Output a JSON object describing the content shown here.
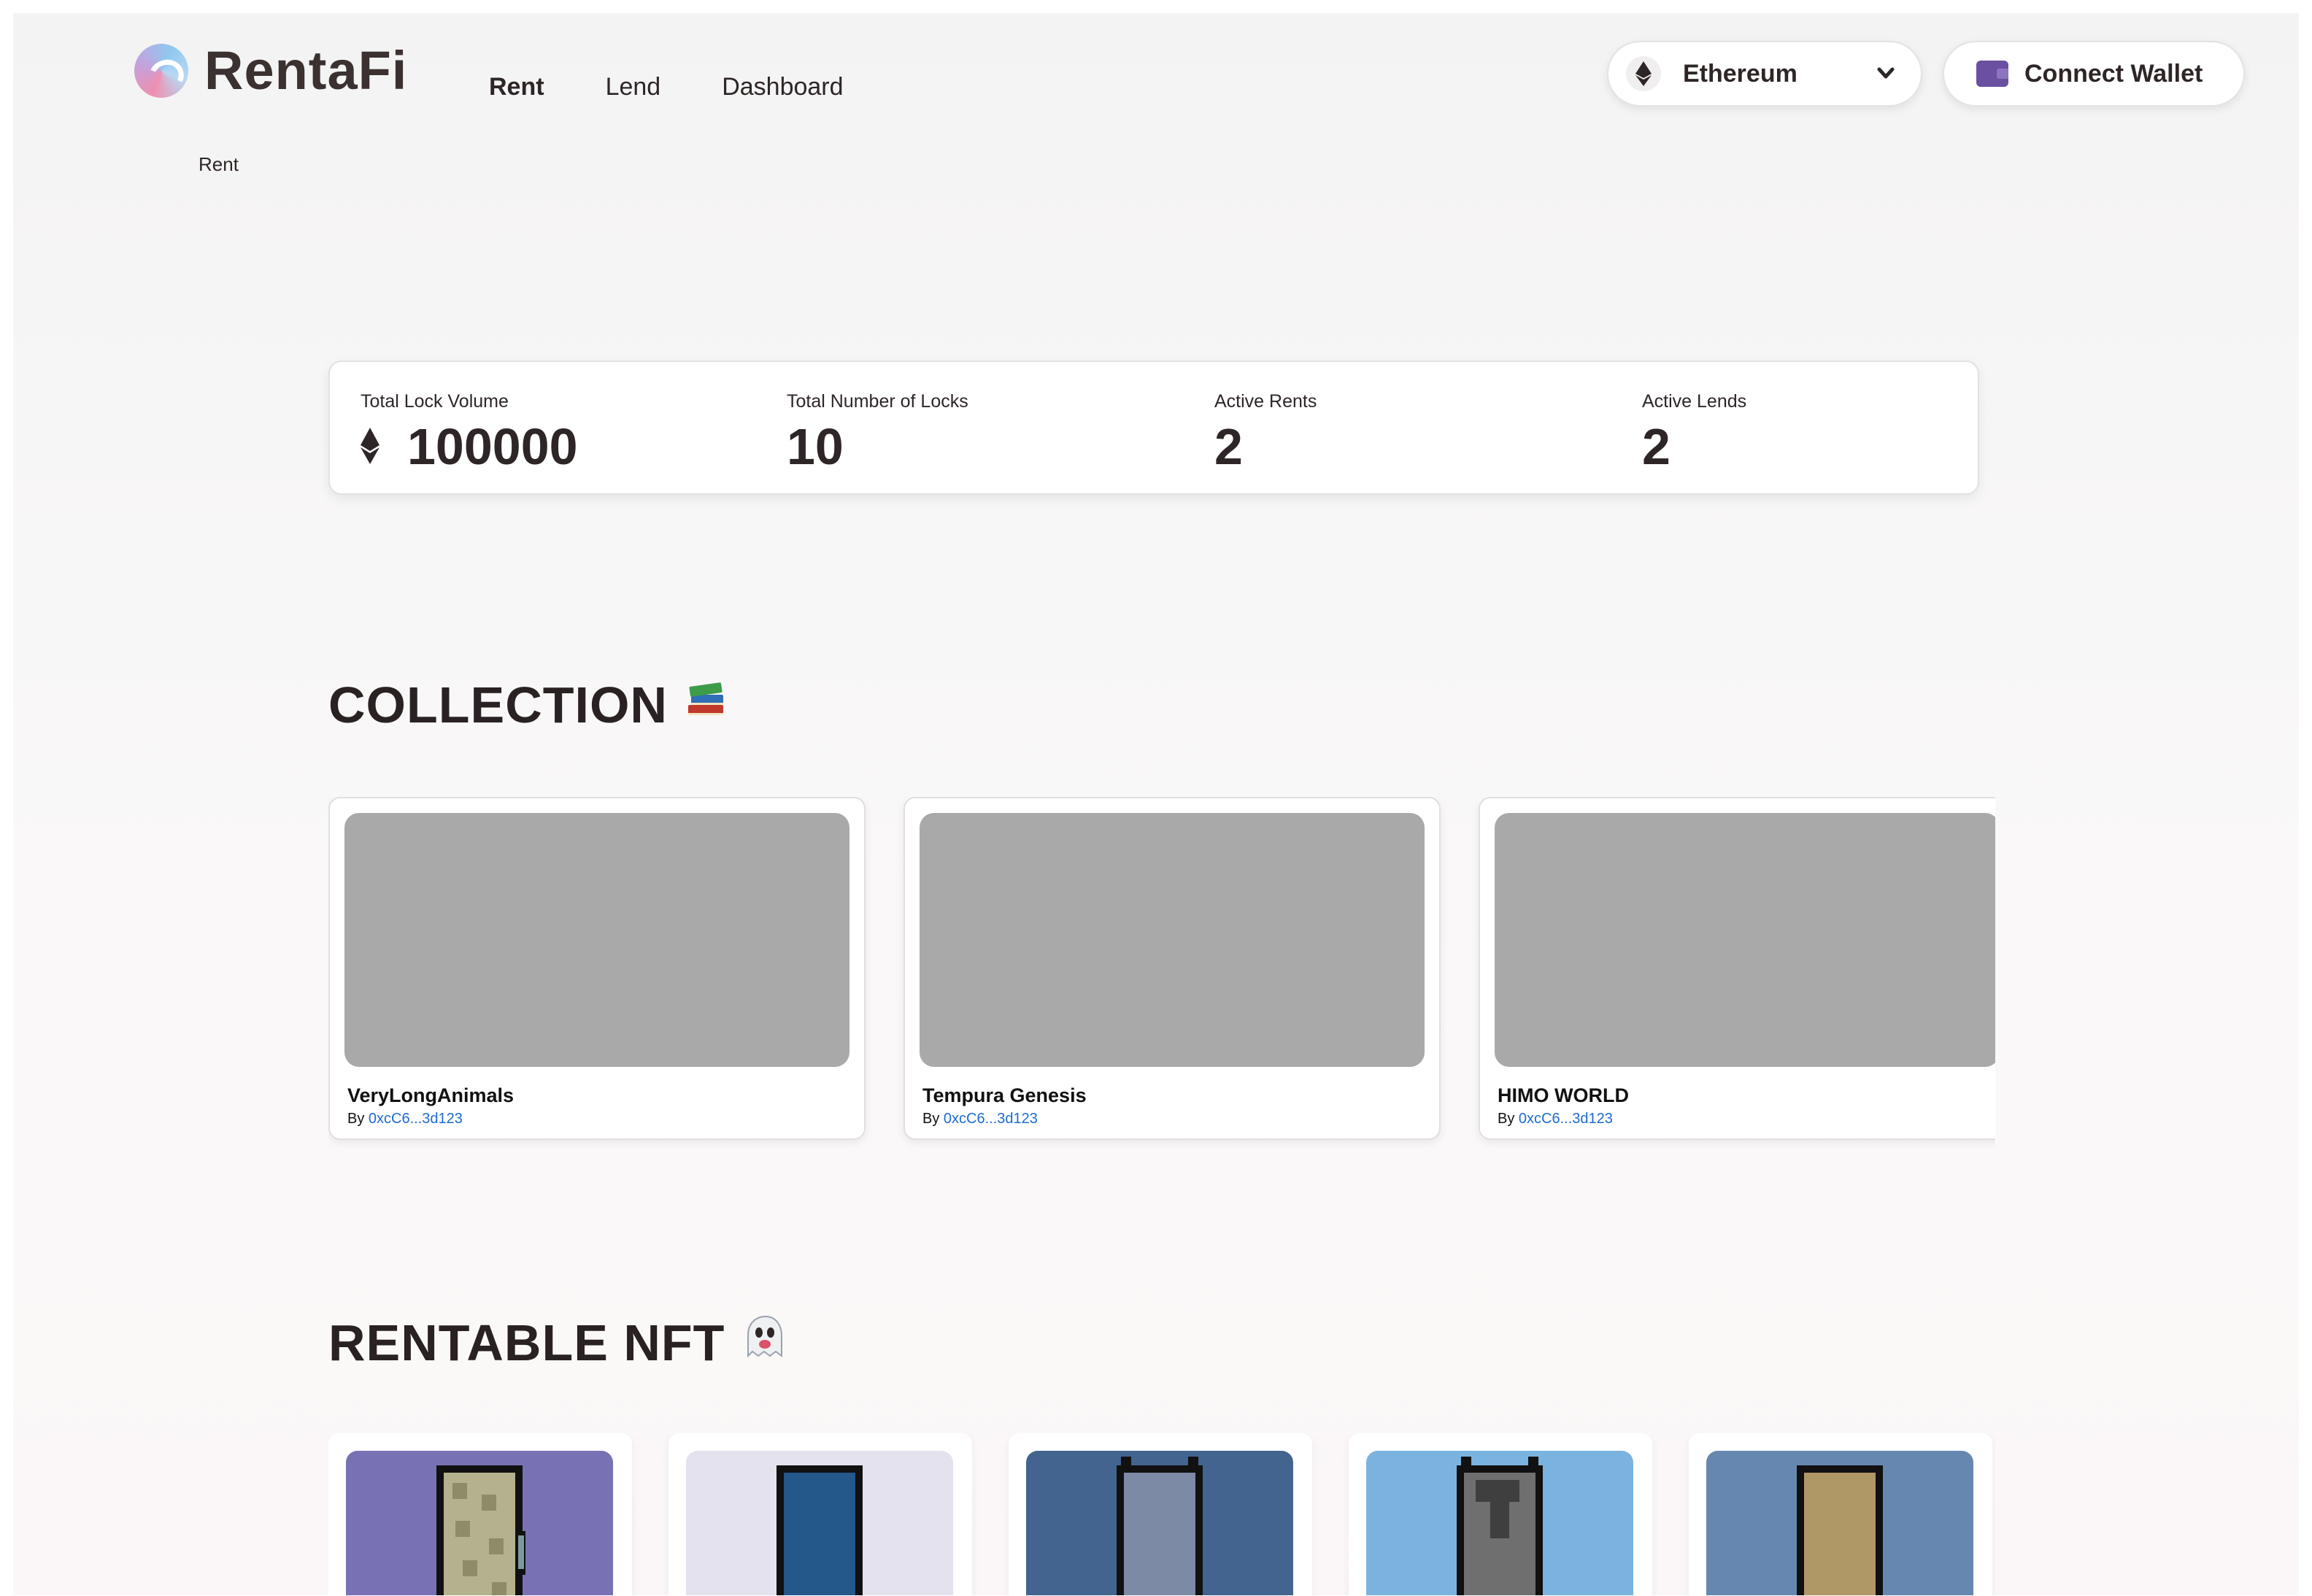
{
  "header": {
    "logo_text": "RentaFi",
    "nav": [
      {
        "label": "Rent",
        "active": true
      },
      {
        "label": "Lend",
        "active": false
      },
      {
        "label": "Dashboard",
        "active": false
      }
    ],
    "chain_select": {
      "value": "Ethereum",
      "icon": "ethereum-icon"
    },
    "wallet_button": {
      "label": "Connect Wallet",
      "icon": "wallet-icon"
    }
  },
  "breadcrumb": "Rent",
  "stats": [
    {
      "label": "Total Lock Volume",
      "value": "100000",
      "icon": "ethereum-icon"
    },
    {
      "label": "Total Number of Locks",
      "value": "10"
    },
    {
      "label": "Active Rents",
      "value": "2"
    },
    {
      "label": "Active Lends",
      "value": "2"
    }
  ],
  "collection": {
    "title": "COLLECTION",
    "emoji": "📚",
    "items": [
      {
        "name": "VeryLongAnimals",
        "by_label": "By",
        "creator": "0xcC6...3d123"
      },
      {
        "name": "Tempura Genesis",
        "by_label": "By",
        "creator": "0xcC6...3d123"
      },
      {
        "name": "HIMO WORLD",
        "by_label": "By",
        "creator": "0xcC6...3d123"
      }
    ]
  },
  "rentable": {
    "title": "RENTABLE NFT",
    "emoji": "👻",
    "items": [
      {
        "bg": "#7872b5",
        "body": "#b5b18f"
      },
      {
        "bg": "#e5e2f0",
        "body": "#24578a"
      },
      {
        "bg": "#43648f",
        "body": "#7d8aa6"
      },
      {
        "bg": "#7bb3e0",
        "body": "#6f6f6f"
      },
      {
        "bg": "#6688b0",
        "body": "#b09766"
      }
    ]
  },
  "colors": {
    "accent_link": "#1d6bd0",
    "wallet_purple": "#6b4fa0",
    "thumb_placeholder": "#a9a9a9"
  }
}
